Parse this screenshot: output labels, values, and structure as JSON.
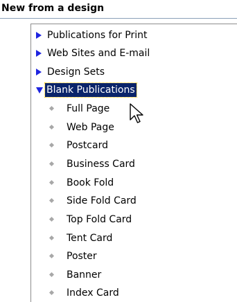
{
  "section": {
    "title": "New from a design"
  },
  "tree": {
    "categories": [
      {
        "label": "Publications for Print",
        "state": "collapsed"
      },
      {
        "label": "Web Sites and E-mail",
        "state": "collapsed"
      },
      {
        "label": "Design Sets",
        "state": "collapsed"
      },
      {
        "label": "Blank Publications",
        "state": "expanded",
        "selected": true
      }
    ],
    "children": [
      {
        "label": "Full Page"
      },
      {
        "label": "Web Page"
      },
      {
        "label": "Postcard"
      },
      {
        "label": "Business Card"
      },
      {
        "label": "Book Fold"
      },
      {
        "label": "Side Fold Card"
      },
      {
        "label": "Top Fold Card"
      },
      {
        "label": "Tent Card"
      },
      {
        "label": "Poster"
      },
      {
        "label": "Banner"
      },
      {
        "label": "Index Card"
      }
    ]
  },
  "colors": {
    "expander": "#1e24e0",
    "selection": "#0a246a",
    "bullet": "#a8a8a8"
  },
  "icons": {
    "expander_collapsed": "triangle-right-icon",
    "expander_expanded": "triangle-down-icon",
    "leaf": "diamond-bullet-icon",
    "pointer": "mouse-pointer-icon"
  }
}
